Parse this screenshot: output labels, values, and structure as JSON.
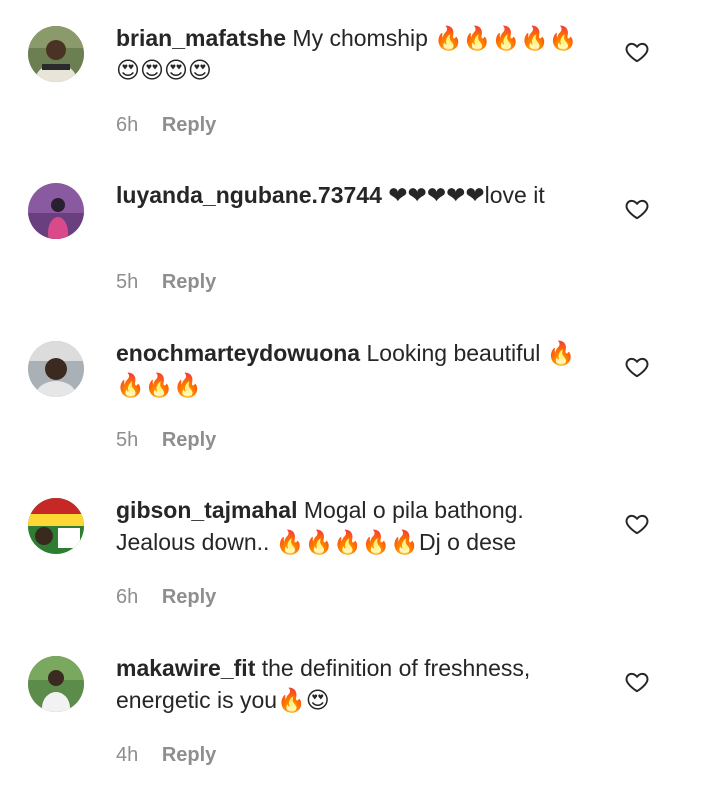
{
  "comments": [
    {
      "username": "brian_mafatshe",
      "text": "My chomship 🔥🔥🔥🔥🔥😍😍😍😍",
      "time": "6h",
      "reply_label": "Reply",
      "avatar_colors": [
        "#6b7f52",
        "#e8e4d8",
        "#4a3324"
      ]
    },
    {
      "username": "luyanda_ngubane.73744",
      "text": "❤❤❤❤❤love it",
      "time": "5h",
      "reply_label": "Reply",
      "avatar_colors": [
        "#8a5aa0",
        "#d94a8a",
        "#2a1f2e"
      ]
    },
    {
      "username": "enochmarteydowuona",
      "text": "Looking beautiful 🔥🔥🔥🔥",
      "time": "5h",
      "reply_label": "Reply",
      "avatar_colors": [
        "#a9b1b7",
        "#dcdcdc",
        "#3b2a20"
      ]
    },
    {
      "username": "gibson_tajmahal",
      "text": "Mogal o pila bathong. Jealous down.. 🔥🔥🔥🔥🔥Dj o dese",
      "time": "6h",
      "reply_label": "Reply",
      "avatar_colors": [
        "#2e7d32",
        "#fdd835",
        "#c62828"
      ]
    },
    {
      "username": "makawire_fit",
      "text": "the definition of freshness, energetic is you🔥😍",
      "time": "4h",
      "reply_label": "Reply",
      "avatar_colors": [
        "#5b8c4a",
        "#f2f2f2",
        "#3a2a22"
      ]
    }
  ],
  "icons": {
    "like": "heart-outline-icon"
  },
  "colors": {
    "username": "#262626",
    "text": "#262626",
    "meta": "#8e8e8e",
    "background": "#ffffff"
  }
}
